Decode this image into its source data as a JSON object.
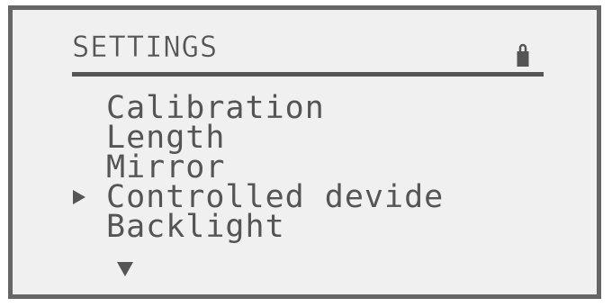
{
  "header": {
    "title": "SETTINGS",
    "status_icon": "lock-icon"
  },
  "menu": {
    "selected_index": 3,
    "items": [
      {
        "label": "Calibration"
      },
      {
        "label": "Length"
      },
      {
        "label": "Mirror"
      },
      {
        "label": "Controlled devide"
      },
      {
        "label": "Backlight"
      }
    ],
    "more_indicator": "chevron-down-icon"
  },
  "colors": {
    "screen_background": "#f0f0f0",
    "foreground": "#555555",
    "bezel": "#666666"
  }
}
